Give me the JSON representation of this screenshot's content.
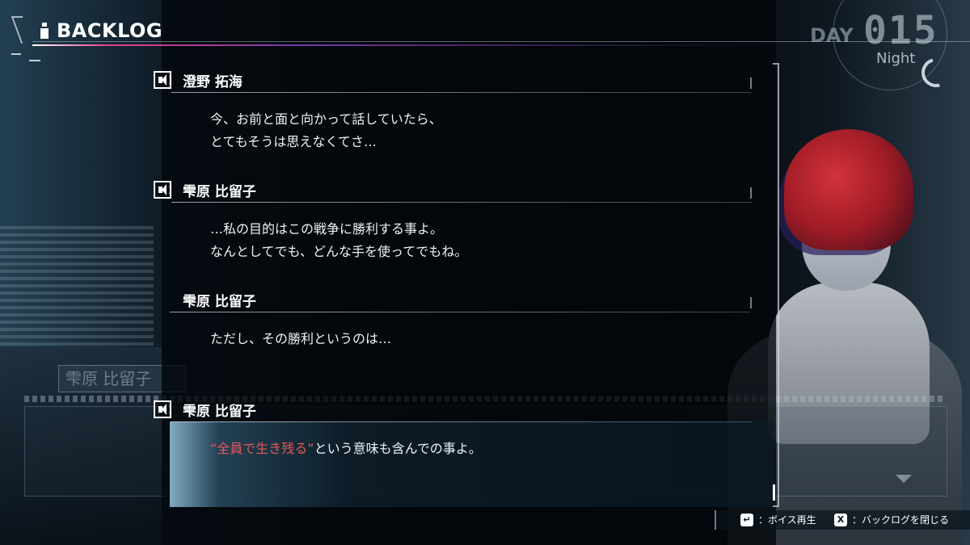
{
  "header": {
    "title": "BACKLOG"
  },
  "day": {
    "label": "DAY",
    "number": "015",
    "time": "Night"
  },
  "entries": [
    {
      "speaker": "澄野 拓海",
      "voice": true,
      "lines": [
        "今、お前と面と向かって話していたら、",
        "とてもそうは思えなくてさ…"
      ]
    },
    {
      "speaker": "雫原 比留子",
      "voice": true,
      "lines": [
        "…私の目的はこの戦争に勝利する事よ。",
        "なんとしてでも、どんな手を使ってでもね。"
      ]
    },
    {
      "speaker": "雫原 比留子",
      "voice": false,
      "lines": [
        "ただし、その勝利というのは…"
      ]
    },
    {
      "speaker": "雫原 比留子",
      "voice": true,
      "highlight": "“全員で生き残る”",
      "rest": "という意味も含んでの事よ。"
    }
  ],
  "ghost": {
    "name": "雫原 比留子"
  },
  "footer": {
    "voice_key": "↵",
    "voice_label": "：ボイス再生",
    "close_key": "X",
    "close_label": "：バックログを閉じる"
  },
  "colors": {
    "accent_pink": "#e33f86",
    "highlight_red": "#e8585a"
  }
}
